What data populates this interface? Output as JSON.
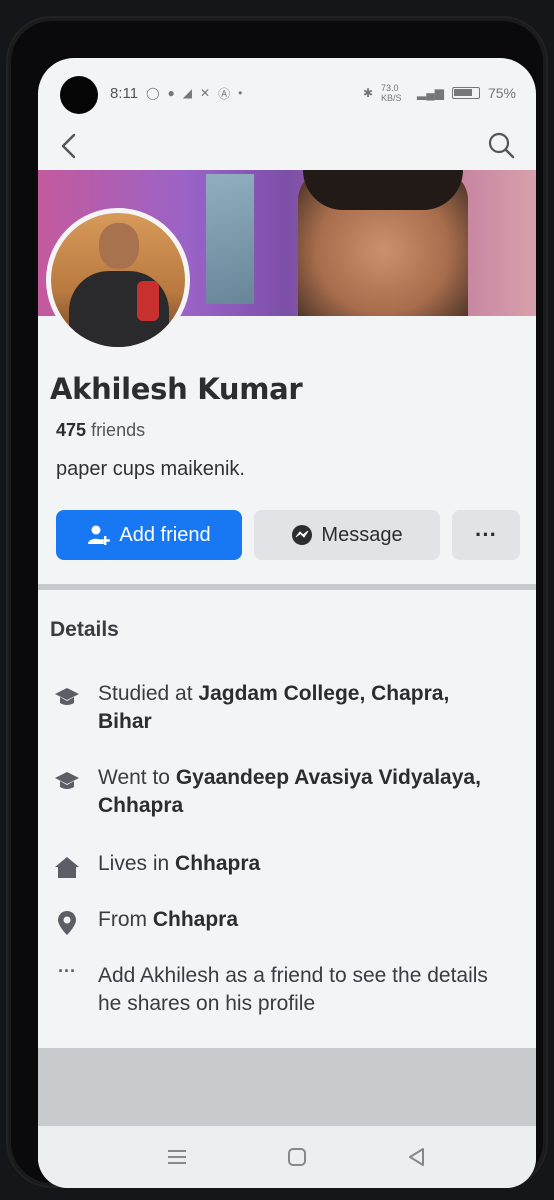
{
  "status_bar": {
    "time": "8:11",
    "network_speed": "73.0 KB/S",
    "battery": "75%"
  },
  "profile": {
    "name": "Akhilesh Kumar",
    "friends_count": "475",
    "friends_label": "friends",
    "bio": "paper cups maikenik."
  },
  "actions": {
    "add_friend": "Add friend",
    "message": "Message",
    "more": "···"
  },
  "details": {
    "title": "Details",
    "studied_prefix": "Studied at ",
    "studied_place": "Jagdam College, Chapra, Bihar",
    "went_prefix": "Went to ",
    "went_place": "Gyaandeep Avasiya Vidyalaya, Chhapra",
    "lives_prefix": "Lives in ",
    "lives_place": "Chhapra",
    "from_prefix": "From ",
    "from_place": "Chhapra",
    "friend_notice": "Add Akhilesh as a friend to see the details he shares on his profile"
  },
  "colors": {
    "accent": "#1877f2",
    "secondary_button": "#e1e3e7",
    "page_bg": "#f3f4f6"
  },
  "icons": [
    "back-icon",
    "search-icon",
    "add-friend-icon",
    "messenger-icon",
    "education-icon",
    "home-icon",
    "location-pin-icon",
    "more-dots-icon",
    "menu-icon",
    "home-square-icon",
    "back-triangle-icon"
  ]
}
